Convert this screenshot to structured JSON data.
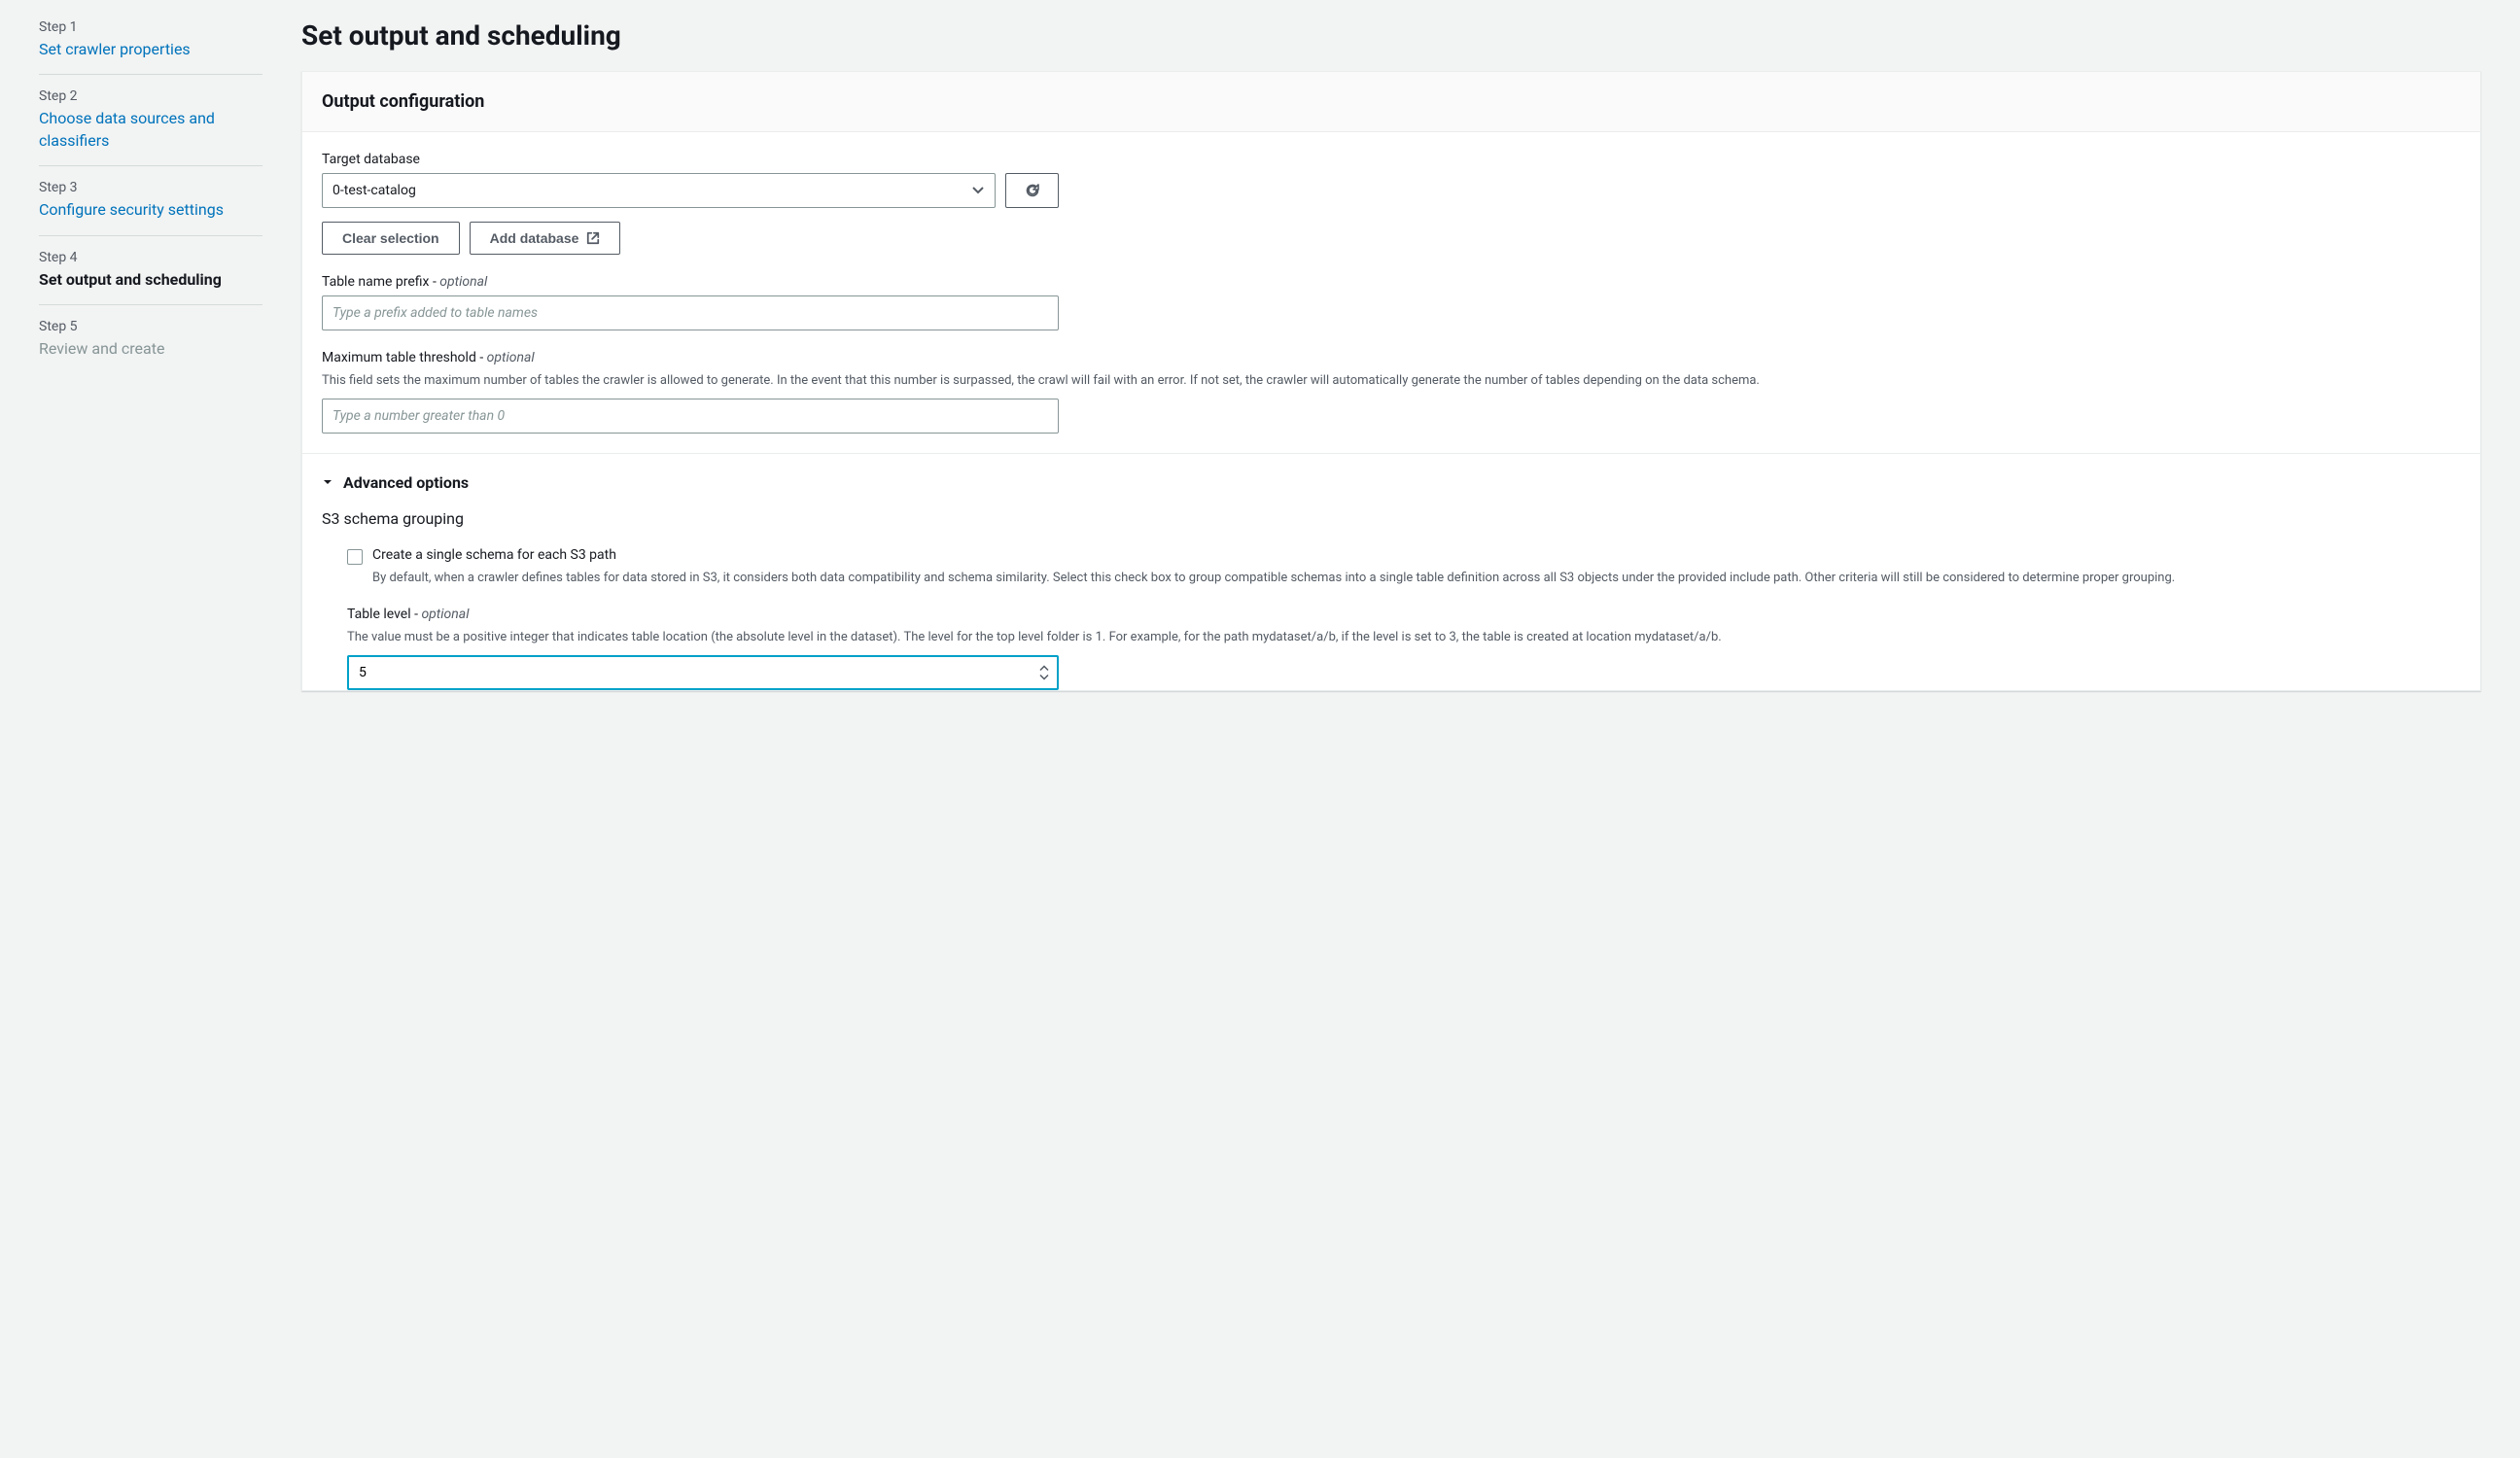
{
  "sidebar": {
    "steps": [
      {
        "number": "Step 1",
        "title": "Set crawler properties",
        "state": "link"
      },
      {
        "number": "Step 2",
        "title": "Choose data sources and classifiers",
        "state": "link"
      },
      {
        "number": "Step 3",
        "title": "Configure security settings",
        "state": "link"
      },
      {
        "number": "Step 4",
        "title": "Set output and scheduling",
        "state": "active"
      },
      {
        "number": "Step 5",
        "title": "Review and create",
        "state": "disabled"
      }
    ]
  },
  "page": {
    "title": "Set output and scheduling"
  },
  "output_config": {
    "panel_title": "Output configuration",
    "target_database": {
      "label": "Target database",
      "value": "0-test-catalog",
      "clear_button": "Clear selection",
      "add_button": "Add database"
    },
    "table_prefix": {
      "label": "Table name prefix - ",
      "optional": "optional",
      "placeholder": "Type a prefix added to table names",
      "value": ""
    },
    "max_threshold": {
      "label": "Maximum table threshold - ",
      "optional": "optional",
      "description": "This field sets the maximum number of tables the crawler is allowed to generate. In the event that this number is surpassed, the crawl will fail with an error. If not set, the crawler will automatically generate the number of tables depending on the data schema.",
      "placeholder": "Type a number greater than 0",
      "value": ""
    },
    "advanced": {
      "title": "Advanced options",
      "s3_schema": {
        "heading": "S3 schema grouping",
        "checkbox_label": "Create a single schema for each S3 path",
        "checkbox_description": "By default, when a crawler defines tables for data stored in S3, it considers both data compatibility and schema similarity. Select this check box to group compatible schemas into a single table definition across all S3 objects under the provided include path. Other criteria will still be considered to determine proper grouping.",
        "checked": false
      },
      "table_level": {
        "label": "Table level - ",
        "optional": "optional",
        "description": "The value must be a positive integer that indicates table location (the absolute level in the dataset). The level for the top level folder is 1. For example, for the path mydataset/a/b, if the level is set to 3, the table is created at location mydataset/a/b.",
        "value": "5"
      }
    }
  }
}
